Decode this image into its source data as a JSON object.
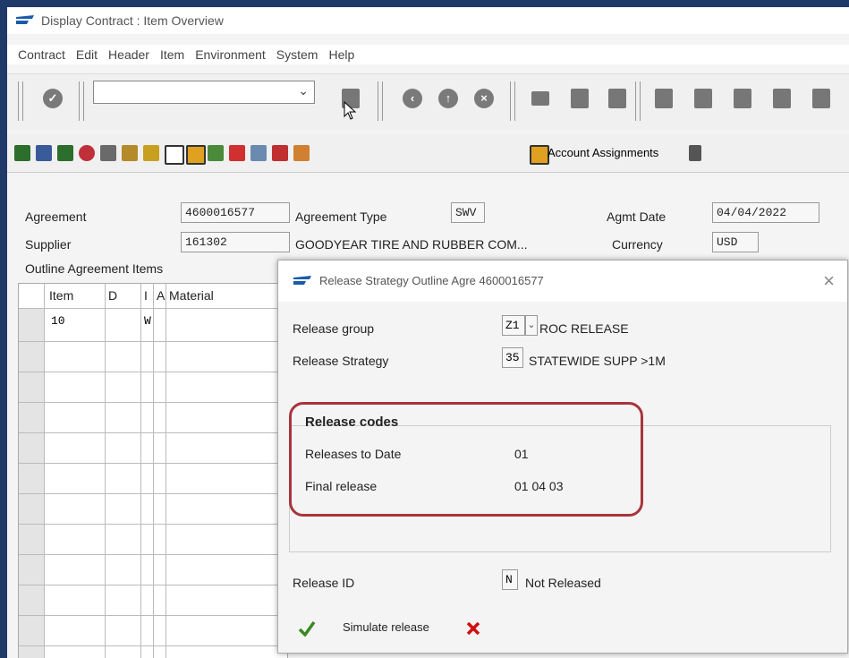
{
  "window": {
    "title": "Display Contract : Item Overview"
  },
  "menu": [
    "Contract",
    "Edit",
    "Header",
    "Item",
    "Environment",
    "System",
    "Help"
  ],
  "toolbar2": {
    "account_assignments": "Account Assignments"
  },
  "header": {
    "agreement_label": "Agreement",
    "agreement_value": "4600016577",
    "agreement_type_label": "Agreement Type",
    "agreement_type_value": "SWV",
    "agmt_date_label": "Agmt Date",
    "agmt_date_value": "04/04/2022",
    "supplier_label": "Supplier",
    "supplier_value": "161302",
    "supplier_name": "GOODYEAR TIRE AND RUBBER COM...",
    "currency_label": "Currency",
    "currency_value": "USD"
  },
  "items": {
    "title": "Outline Agreement Items",
    "columns": [
      "Item",
      "D",
      "I",
      "A",
      "Material"
    ],
    "rows": [
      {
        "item": "10",
        "d": "",
        "i": "W",
        "a": "",
        "material": ""
      }
    ]
  },
  "dialog": {
    "title": "Release Strategy Outline Agre 4600016577",
    "release_group_label": "Release group",
    "release_group_value": "Z1",
    "release_group_desc": "ROC RELEASE",
    "release_strategy_label": "Release Strategy",
    "release_strategy_value": "35",
    "release_strategy_desc": "STATEWIDE SUPP >1M",
    "release_codes_title": "Release codes",
    "releases_to_date_label": "Releases to Date",
    "releases_to_date_value": "01",
    "final_release_label": "Final release",
    "final_release_value": "01 04 03",
    "release_id_label": "Release ID",
    "release_id_value": "N",
    "release_id_desc": "Not Released",
    "simulate_label": "Simulate release"
  },
  "colors": {
    "highlight": "#a8343d",
    "sap_blue": "#1a5ba8",
    "check_green": "#3a8a22",
    "cancel_red": "#d01010"
  }
}
